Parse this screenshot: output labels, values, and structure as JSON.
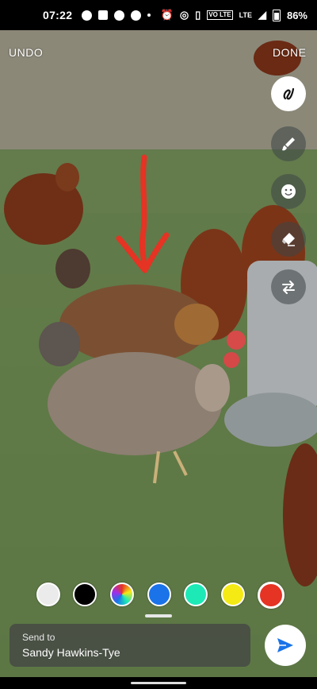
{
  "status_bar": {
    "time": "07:22",
    "battery": "86%",
    "network": "LTE",
    "volte": "VO LTE"
  },
  "top": {
    "undo_label": "UNDO",
    "done_label": "DONE"
  },
  "tools": [
    {
      "name": "draw-tool",
      "icon": "squiggle-icon",
      "selected": true
    },
    {
      "name": "brush-tool",
      "icon": "brush-icon",
      "selected": false
    },
    {
      "name": "sticker-tool",
      "icon": "smiley-icon",
      "selected": false
    },
    {
      "name": "eraser-tool",
      "icon": "eraser-icon",
      "selected": false
    },
    {
      "name": "swap-tool",
      "icon": "swap-icon",
      "selected": false
    }
  ],
  "colors": [
    {
      "name": "white",
      "hex": "#ebebeb"
    },
    {
      "name": "black",
      "hex": "#000000"
    },
    {
      "name": "rainbow",
      "hex": "multicolor"
    },
    {
      "name": "blue",
      "hex": "#1a73e8"
    },
    {
      "name": "teal",
      "hex": "#1de9b6"
    },
    {
      "name": "yellow",
      "hex": "#f5ea14"
    },
    {
      "name": "red",
      "hex": "#e53324"
    }
  ],
  "send": {
    "label": "Send to",
    "recipient": "Sandy Hawkins-Tye"
  },
  "annotation": {
    "type": "red-arrow",
    "color": "#e53324"
  }
}
